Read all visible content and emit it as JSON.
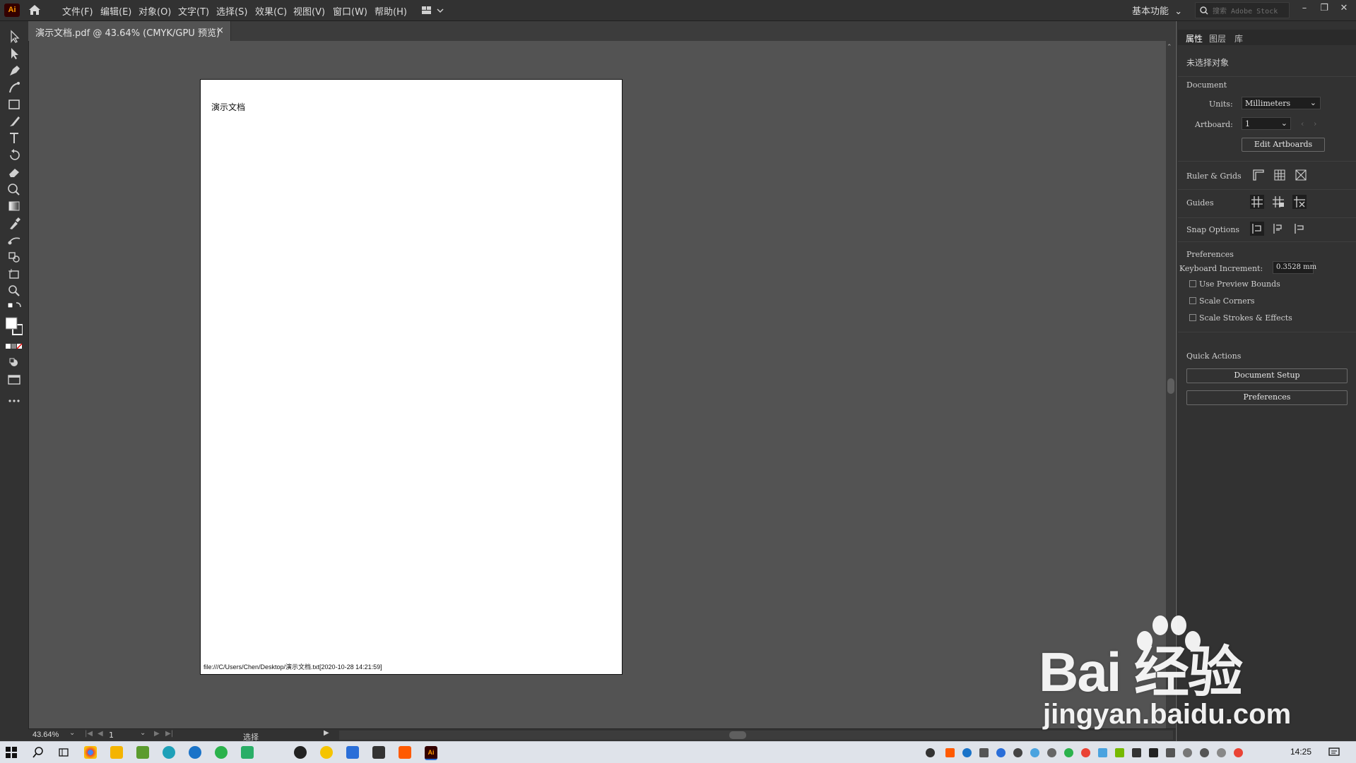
{
  "app": {
    "logo": "Ai"
  },
  "menubar": {
    "items": [
      "文件(F)",
      "编辑(E)",
      "对象(O)",
      "文字(T)",
      "选择(S)",
      "效果(C)",
      "视图(V)",
      "窗口(W)",
      "帮助(H)"
    ],
    "workspace": "基本功能",
    "stock_search_placeholder": "搜索 Adobe Stock"
  },
  "document_tab": {
    "label": "演示文档.pdf @ 43.64% (CMYK/GPU 预览)",
    "close": "×"
  },
  "artboard": {
    "title": "演示文档",
    "footer": "file:///C/Users/Chen/Desktop/演示文档.txt[2020-10-28 14:21:59]"
  },
  "statusbar": {
    "zoom": "43.64%",
    "artboard_number": "1",
    "tool": "选择"
  },
  "panel": {
    "tabs": [
      "属性",
      "图层",
      "库"
    ],
    "no_selection": "未选择对象",
    "document": {
      "heading": "Document",
      "units_label": "Units:",
      "units_value": "Millimeters",
      "artboard_label": "Artboard:",
      "artboard_value": "1",
      "edit_artboards": "Edit Artboards"
    },
    "ruler_grids": "Ruler & Grids",
    "guides": "Guides",
    "snap_options": "Snap Options",
    "preferences": {
      "heading": "Preferences",
      "keyboard_increment_label": "Keyboard Increment:",
      "keyboard_increment_value": "0.3528 mm",
      "checkboxes": [
        "Use Preview Bounds",
        "Scale Corners",
        "Scale Strokes & Effects"
      ]
    },
    "quick_actions": {
      "heading": "Quick Actions",
      "document_setup": "Document Setup",
      "preferences": "Preferences"
    }
  },
  "taskbar": {
    "time": "14:25"
  },
  "watermark": {
    "brand": "Bai 经验",
    "url": "jingyan.baidu.com"
  },
  "colors": {
    "accent_app": "#ff9a00",
    "ui_dark": "#323232",
    "canvas": "#535353"
  }
}
